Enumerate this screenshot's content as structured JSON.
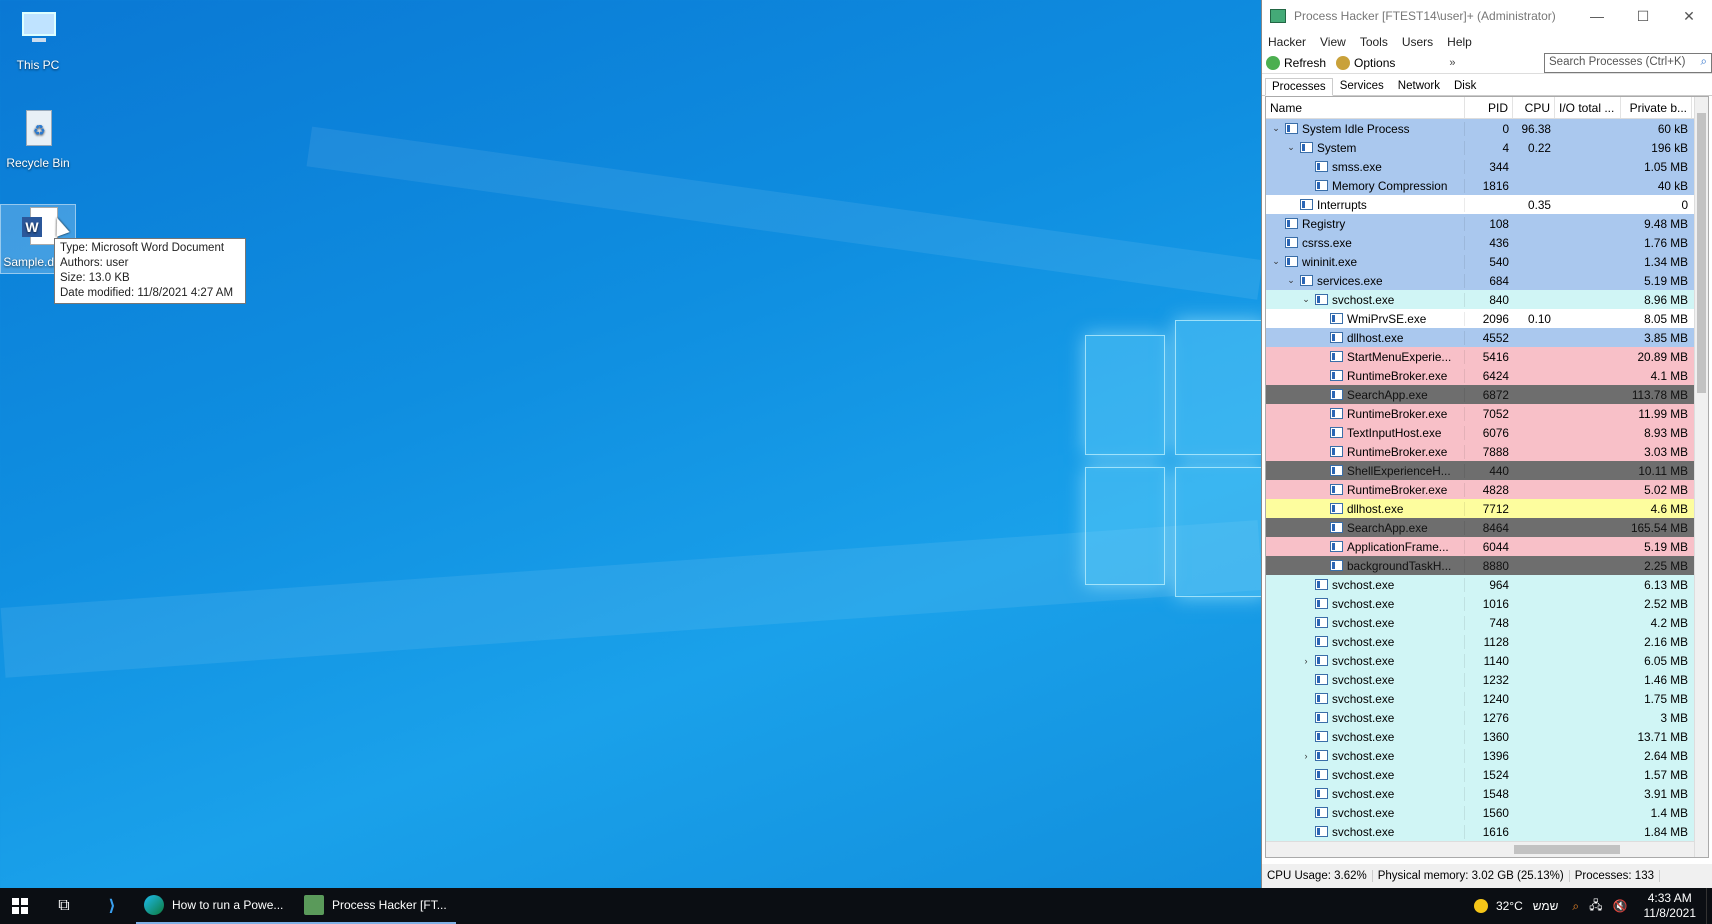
{
  "desktop": {
    "icons": [
      {
        "label": "This PC",
        "icon": "this-pc-icon"
      },
      {
        "label": "Recycle Bin",
        "icon": "recycle-bin-icon"
      },
      {
        "label": "Sample.docx",
        "icon": "word-document-icon"
      }
    ],
    "tooltip": {
      "line1": "Type: Microsoft Word Document",
      "line2": "Authors: user",
      "line3": "Size: 13.0 KB",
      "line4": "Date modified: 11/8/2021 4:27 AM"
    }
  },
  "window": {
    "title": "Process Hacker [FTEST14\\user]+ (Administrator)",
    "menu": [
      "Hacker",
      "View",
      "Tools",
      "Users",
      "Help"
    ],
    "toolbar": {
      "refresh": "Refresh",
      "options": "Options",
      "search_placeholder": "Search Processes (Ctrl+K)"
    },
    "tabs": [
      "Processes",
      "Services",
      "Network",
      "Disk"
    ],
    "columns": {
      "name": "Name",
      "pid": "PID",
      "cpu": "CPU",
      "io": "I/O total ...",
      "private": "Private b..."
    },
    "rows": [
      {
        "name": "System Idle Process",
        "pid": "0",
        "cpu": "96.38",
        "priv": "60 kB",
        "color": "blue",
        "level": 0,
        "exp": "v"
      },
      {
        "name": "System",
        "pid": "4",
        "cpu": "0.22",
        "priv": "196 kB",
        "color": "blue",
        "level": 1,
        "exp": "v"
      },
      {
        "name": "smss.exe",
        "pid": "344",
        "cpu": "",
        "priv": "1.05 MB",
        "color": "blue",
        "level": 2,
        "exp": ""
      },
      {
        "name": "Memory Compression",
        "pid": "1816",
        "cpu": "",
        "priv": "40 kB",
        "color": "blue",
        "level": 2,
        "exp": ""
      },
      {
        "name": "Interrupts",
        "pid": "",
        "cpu": "0.35",
        "priv": "0",
        "color": "white",
        "level": 1,
        "exp": ""
      },
      {
        "name": "Registry",
        "pid": "108",
        "cpu": "",
        "priv": "9.48 MB",
        "color": "blue",
        "level": 0,
        "exp": ""
      },
      {
        "name": "csrss.exe",
        "pid": "436",
        "cpu": "",
        "priv": "1.76 MB",
        "color": "blue",
        "level": 0,
        "exp": ""
      },
      {
        "name": "wininit.exe",
        "pid": "540",
        "cpu": "",
        "priv": "1.34 MB",
        "color": "blue",
        "level": 0,
        "exp": "v"
      },
      {
        "name": "services.exe",
        "pid": "684",
        "cpu": "",
        "priv": "5.19 MB",
        "color": "blue",
        "level": 1,
        "exp": "v"
      },
      {
        "name": "svchost.exe",
        "pid": "840",
        "cpu": "",
        "priv": "8.96 MB",
        "color": "cyan",
        "level": 2,
        "exp": "v"
      },
      {
        "name": "WmiPrvSE.exe",
        "pid": "2096",
        "cpu": "0.10",
        "priv": "8.05 MB",
        "color": "white",
        "level": 3,
        "exp": ""
      },
      {
        "name": "dllhost.exe",
        "pid": "4552",
        "cpu": "",
        "priv": "3.85 MB",
        "color": "blue",
        "level": 3,
        "exp": ""
      },
      {
        "name": "StartMenuExperie...",
        "pid": "5416",
        "cpu": "",
        "priv": "20.89 MB",
        "color": "pink",
        "level": 3,
        "exp": ""
      },
      {
        "name": "RuntimeBroker.exe",
        "pid": "6424",
        "cpu": "",
        "priv": "4.1 MB",
        "color": "pink",
        "level": 3,
        "exp": ""
      },
      {
        "name": "SearchApp.exe",
        "pid": "6872",
        "cpu": "",
        "priv": "113.78 MB",
        "color": "dark",
        "level": 3,
        "exp": ""
      },
      {
        "name": "RuntimeBroker.exe",
        "pid": "7052",
        "cpu": "",
        "priv": "11.99 MB",
        "color": "pink",
        "level": 3,
        "exp": ""
      },
      {
        "name": "TextInputHost.exe",
        "pid": "6076",
        "cpu": "",
        "priv": "8.93 MB",
        "color": "pink",
        "level": 3,
        "exp": ""
      },
      {
        "name": "RuntimeBroker.exe",
        "pid": "7888",
        "cpu": "",
        "priv": "3.03 MB",
        "color": "pink",
        "level": 3,
        "exp": ""
      },
      {
        "name": "ShellExperienceH...",
        "pid": "440",
        "cpu": "",
        "priv": "10.11 MB",
        "color": "dark",
        "level": 3,
        "exp": ""
      },
      {
        "name": "RuntimeBroker.exe",
        "pid": "4828",
        "cpu": "",
        "priv": "5.02 MB",
        "color": "pink",
        "level": 3,
        "exp": ""
      },
      {
        "name": "dllhost.exe",
        "pid": "7712",
        "cpu": "",
        "priv": "4.6 MB",
        "color": "yellow",
        "level": 3,
        "exp": ""
      },
      {
        "name": "SearchApp.exe",
        "pid": "8464",
        "cpu": "",
        "priv": "165.54 MB",
        "color": "dark",
        "level": 3,
        "exp": ""
      },
      {
        "name": "ApplicationFrame...",
        "pid": "6044",
        "cpu": "",
        "priv": "5.19 MB",
        "color": "pink",
        "level": 3,
        "exp": ""
      },
      {
        "name": "backgroundTaskH...",
        "pid": "8880",
        "cpu": "",
        "priv": "2.25 MB",
        "color": "dark",
        "level": 3,
        "exp": ""
      },
      {
        "name": "svchost.exe",
        "pid": "964",
        "cpu": "",
        "priv": "6.13 MB",
        "color": "cyan",
        "level": 2,
        "exp": ""
      },
      {
        "name": "svchost.exe",
        "pid": "1016",
        "cpu": "",
        "priv": "2.52 MB",
        "color": "cyan",
        "level": 2,
        "exp": ""
      },
      {
        "name": "svchost.exe",
        "pid": "748",
        "cpu": "",
        "priv": "4.2 MB",
        "color": "cyan",
        "level": 2,
        "exp": ""
      },
      {
        "name": "svchost.exe",
        "pid": "1128",
        "cpu": "",
        "priv": "2.16 MB",
        "color": "cyan",
        "level": 2,
        "exp": ""
      },
      {
        "name": "svchost.exe",
        "pid": "1140",
        "cpu": "",
        "priv": "6.05 MB",
        "color": "cyan",
        "level": 2,
        "exp": ">"
      },
      {
        "name": "svchost.exe",
        "pid": "1232",
        "cpu": "",
        "priv": "1.46 MB",
        "color": "cyan",
        "level": 2,
        "exp": ""
      },
      {
        "name": "svchost.exe",
        "pid": "1240",
        "cpu": "",
        "priv": "1.75 MB",
        "color": "cyan",
        "level": 2,
        "exp": ""
      },
      {
        "name": "svchost.exe",
        "pid": "1276",
        "cpu": "",
        "priv": "3 MB",
        "color": "cyan",
        "level": 2,
        "exp": ""
      },
      {
        "name": "svchost.exe",
        "pid": "1360",
        "cpu": "",
        "priv": "13.71 MB",
        "color": "cyan",
        "level": 2,
        "exp": ""
      },
      {
        "name": "svchost.exe",
        "pid": "1396",
        "cpu": "",
        "priv": "2.64 MB",
        "color": "cyan",
        "level": 2,
        "exp": ">"
      },
      {
        "name": "svchost.exe",
        "pid": "1524",
        "cpu": "",
        "priv": "1.57 MB",
        "color": "cyan",
        "level": 2,
        "exp": ""
      },
      {
        "name": "svchost.exe",
        "pid": "1548",
        "cpu": "",
        "priv": "3.91 MB",
        "color": "cyan",
        "level": 2,
        "exp": ""
      },
      {
        "name": "svchost.exe",
        "pid": "1560",
        "cpu": "",
        "priv": "1.4 MB",
        "color": "cyan",
        "level": 2,
        "exp": ""
      },
      {
        "name": "svchost.exe",
        "pid": "1616",
        "cpu": "",
        "priv": "1.84 MB",
        "color": "cyan",
        "level": 2,
        "exp": ""
      },
      {
        "name": "svchost.exe",
        "pid": "",
        "cpu": "",
        "priv": "",
        "color": "cyan",
        "level": 2,
        "exp": ""
      }
    ],
    "status": {
      "cpu": "CPU Usage: 3.62%",
      "memory": "Physical memory: 3.02 GB (25.13%)",
      "processes": "Processes: 133"
    }
  },
  "taskbar": {
    "apps": [
      {
        "label": "How to run a Powe...",
        "icon": "edge-icon"
      },
      {
        "label": "Process Hacker [FT...",
        "icon": "process-hacker-icon"
      }
    ],
    "weather": "32°C",
    "language": "שמש",
    "time": "4:33 AM",
    "date": "11/8/2021"
  }
}
